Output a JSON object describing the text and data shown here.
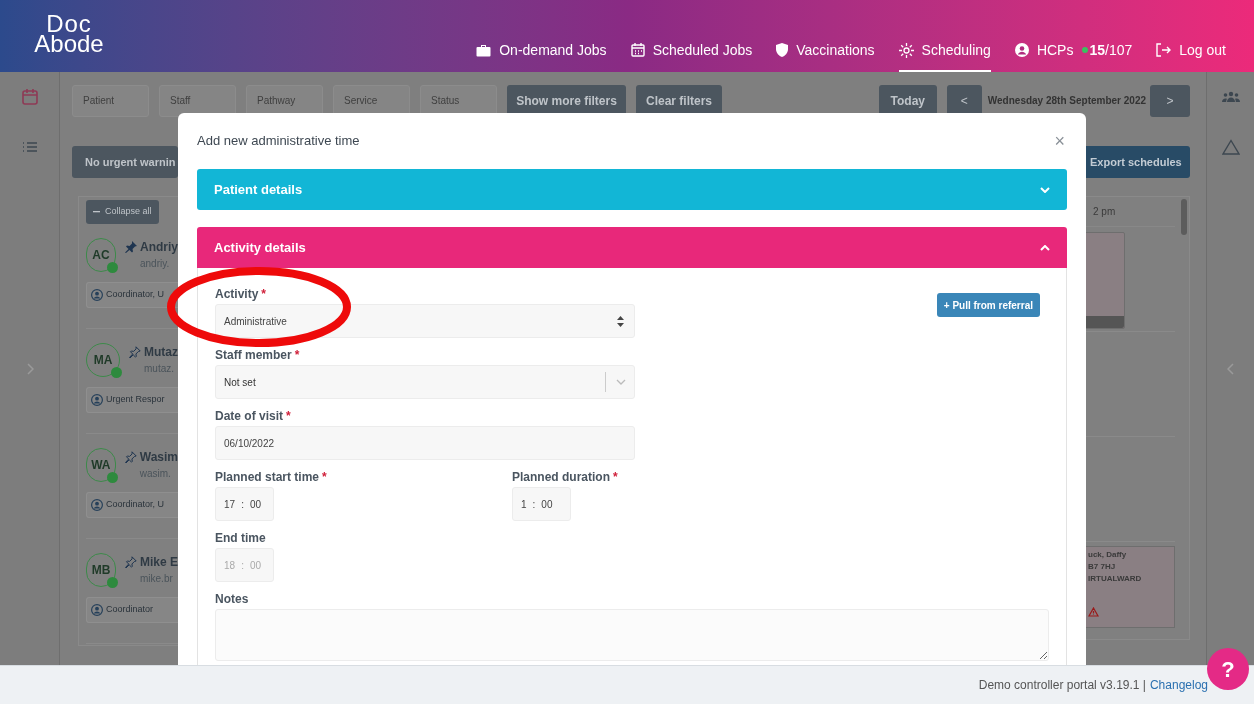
{
  "header": {
    "logo": {
      "line_1": "Doc",
      "line_2": "Abode"
    },
    "nav": [
      {
        "label": "On-demand Jobs",
        "kind": "briefcase",
        "selected": false
      },
      {
        "label": "Scheduled Jobs",
        "kind": "calendar",
        "selected": false
      },
      {
        "label": "Vaccinations",
        "kind": "shield",
        "selected": false
      },
      {
        "label": "Scheduling",
        "kind": "sun",
        "selected": true
      },
      {
        "label": "HCPs",
        "kind": "user",
        "selected": false,
        "count": "15",
        "total": "/107"
      },
      {
        "label": "Log out",
        "kind": "logout",
        "selected": false
      }
    ]
  },
  "filters": {
    "fields": [
      {
        "placeholder": "Patient"
      },
      {
        "placeholder": "Staff"
      },
      {
        "placeholder": "Pathway"
      },
      {
        "placeholder": "Service"
      },
      {
        "placeholder": "Status"
      }
    ],
    "buttons": [
      "Show more filters",
      "Clear filters"
    ],
    "today": "Today",
    "date": "Wednesday 28th September 2022",
    "prev": "<",
    "next": ">"
  },
  "warnings_button": "No urgent warnin",
  "collapse_button": "Collapse all",
  "staff": [
    {
      "initials": "AC",
      "name": "Andriy",
      "email": "andriy.",
      "role": "Coordinator, U",
      "pinned": true
    },
    {
      "initials": "MA",
      "name": "Mutaz",
      "email": "mutaz.",
      "role": "Urgent Respor",
      "pinned": false
    },
    {
      "initials": "WA",
      "name": "Wasim",
      "email": "wasim.",
      "role": "Coordinator, U",
      "pinned": false
    },
    {
      "initials": "MB",
      "name": "Mike E",
      "email": "mike.br",
      "role": "Coordinator",
      "pinned": false
    }
  ],
  "export_button": "Export schedules",
  "schedule": {
    "time_label": "2 pm",
    "visit": [
      "uck, Daffy",
      "B7 7HJ",
      "IRTUALWARD"
    ]
  },
  "modal": {
    "title": "Add new administrative time",
    "close": "×",
    "sections": [
      {
        "title": "Patient details",
        "color": "#12b6d6",
        "expanded": false
      },
      {
        "title": "Activity details",
        "color": "#e8287a",
        "expanded": true
      }
    ],
    "activity": {
      "label": "Activity",
      "required_mark": "*",
      "value": "Administrative"
    },
    "pull_button": "+ Pull from referral",
    "staff_member": {
      "label": "Staff member",
      "required_mark": "*",
      "value": "Not set"
    },
    "date_of_visit": {
      "label": "Date of visit",
      "required_mark": "*",
      "value": "06/10/2022"
    },
    "start_time": {
      "label": "Planned start time",
      "required_mark": "*",
      "hours": "17",
      "separator": ":",
      "minutes": "00",
      "disabled": false
    },
    "duration": {
      "label": "Planned duration",
      "required_mark": "*",
      "hours": "1",
      "separator": ":",
      "minutes": "00",
      "disabled": false
    },
    "end_time": {
      "label": "End time",
      "hours": "18",
      "separator": ":",
      "minutes": "00",
      "disabled": true
    },
    "notes": {
      "label": "Notes"
    }
  },
  "footer": {
    "text": "Demo controller portal v3.19.1 |",
    "link": "Changelog"
  },
  "help_button": "?"
}
